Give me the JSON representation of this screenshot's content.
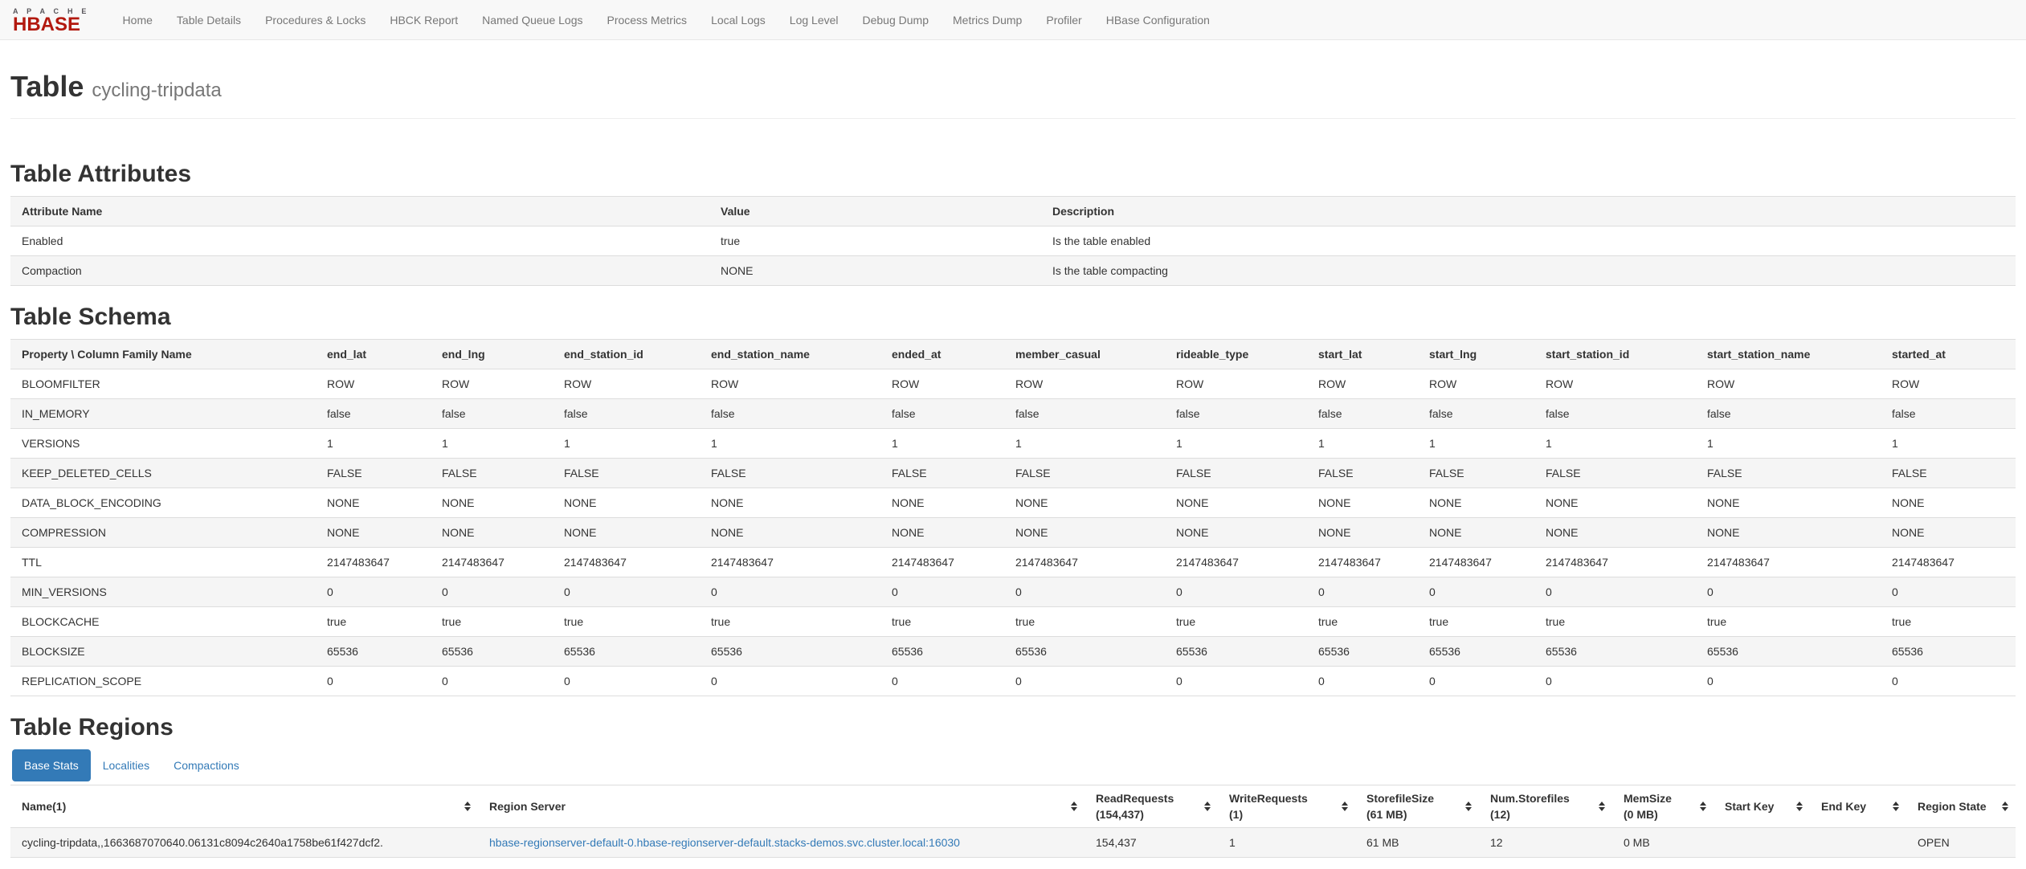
{
  "colors": {
    "accent": "#337ab7",
    "brand_red": "#b2190f",
    "navbar_bg": "#f8f8f8",
    "navbar_border": "#e7e7e7",
    "nav_text": "#777777",
    "text": "#333333",
    "muted": "#777777",
    "table_border": "#dddddd",
    "stripe": "#f5f5f5"
  },
  "nav": {
    "brand_top": "A P A C H E",
    "brand_bottom": "HBASE",
    "items": [
      "Home",
      "Table Details",
      "Procedures & Locks",
      "HBCK Report",
      "Named Queue Logs",
      "Process Metrics",
      "Local Logs",
      "Log Level",
      "Debug Dump",
      "Metrics Dump",
      "Profiler",
      "HBase Configuration"
    ]
  },
  "page": {
    "title": "Table",
    "subtitle": "cycling-tripdata"
  },
  "attributes": {
    "heading": "Table Attributes",
    "columns": [
      "Attribute Name",
      "Value",
      "Description"
    ],
    "rows": [
      [
        "Enabled",
        "true",
        "Is the table enabled"
      ],
      [
        "Compaction",
        "NONE",
        "Is the table compacting"
      ]
    ]
  },
  "schema": {
    "heading": "Table Schema",
    "columns": [
      "Property \\ Column Family Name",
      "end_lat",
      "end_lng",
      "end_station_id",
      "end_station_name",
      "ended_at",
      "member_casual",
      "rideable_type",
      "start_lat",
      "start_lng",
      "start_station_id",
      "start_station_name",
      "started_at"
    ],
    "rows": [
      [
        "BLOOMFILTER",
        "ROW",
        "ROW",
        "ROW",
        "ROW",
        "ROW",
        "ROW",
        "ROW",
        "ROW",
        "ROW",
        "ROW",
        "ROW",
        "ROW"
      ],
      [
        "IN_MEMORY",
        "false",
        "false",
        "false",
        "false",
        "false",
        "false",
        "false",
        "false",
        "false",
        "false",
        "false",
        "false"
      ],
      [
        "VERSIONS",
        "1",
        "1",
        "1",
        "1",
        "1",
        "1",
        "1",
        "1",
        "1",
        "1",
        "1",
        "1"
      ],
      [
        "KEEP_DELETED_CELLS",
        "FALSE",
        "FALSE",
        "FALSE",
        "FALSE",
        "FALSE",
        "FALSE",
        "FALSE",
        "FALSE",
        "FALSE",
        "FALSE",
        "FALSE",
        "FALSE"
      ],
      [
        "DATA_BLOCK_ENCODING",
        "NONE",
        "NONE",
        "NONE",
        "NONE",
        "NONE",
        "NONE",
        "NONE",
        "NONE",
        "NONE",
        "NONE",
        "NONE",
        "NONE"
      ],
      [
        "COMPRESSION",
        "NONE",
        "NONE",
        "NONE",
        "NONE",
        "NONE",
        "NONE",
        "NONE",
        "NONE",
        "NONE",
        "NONE",
        "NONE",
        "NONE"
      ],
      [
        "TTL",
        "2147483647",
        "2147483647",
        "2147483647",
        "2147483647",
        "2147483647",
        "2147483647",
        "2147483647",
        "2147483647",
        "2147483647",
        "2147483647",
        "2147483647",
        "2147483647"
      ],
      [
        "MIN_VERSIONS",
        "0",
        "0",
        "0",
        "0",
        "0",
        "0",
        "0",
        "0",
        "0",
        "0",
        "0",
        "0"
      ],
      [
        "BLOCKCACHE",
        "true",
        "true",
        "true",
        "true",
        "true",
        "true",
        "true",
        "true",
        "true",
        "true",
        "true",
        "true"
      ],
      [
        "BLOCKSIZE",
        "65536",
        "65536",
        "65536",
        "65536",
        "65536",
        "65536",
        "65536",
        "65536",
        "65536",
        "65536",
        "65536",
        "65536"
      ],
      [
        "REPLICATION_SCOPE",
        "0",
        "0",
        "0",
        "0",
        "0",
        "0",
        "0",
        "0",
        "0",
        "0",
        "0",
        "0"
      ]
    ]
  },
  "regions": {
    "heading": "Table Regions",
    "tabs": [
      {
        "label": "Base Stats",
        "active": true
      },
      {
        "label": "Localities",
        "active": false
      },
      {
        "label": "Compactions",
        "active": false
      }
    ],
    "columns": [
      {
        "label": "Name(1)",
        "sub": ""
      },
      {
        "label": "Region Server",
        "sub": ""
      },
      {
        "label": "ReadRequests",
        "sub": "(154,437)"
      },
      {
        "label": "WriteRequests",
        "sub": "(1)"
      },
      {
        "label": "StorefileSize",
        "sub": "(61 MB)"
      },
      {
        "label": "Num.Storefiles",
        "sub": "(12)"
      },
      {
        "label": "MemSize",
        "sub": "(0 MB)"
      },
      {
        "label": "Start Key",
        "sub": ""
      },
      {
        "label": "End Key",
        "sub": ""
      },
      {
        "label": "Region State",
        "sub": ""
      }
    ],
    "rows": [
      {
        "name": "cycling-tripdata,,1663687070640.06131c8094c2640a1758be61f427dcf2.",
        "region_server": "hbase-regionserver-default-0.hbase-regionserver-default.stacks-demos.svc.cluster.local:16030",
        "read_requests": "154,437",
        "write_requests": "1",
        "storefile_size": "61 MB",
        "num_storefiles": "12",
        "mem_size": "0 MB",
        "start_key": "",
        "end_key": "",
        "region_state": "OPEN"
      }
    ]
  }
}
